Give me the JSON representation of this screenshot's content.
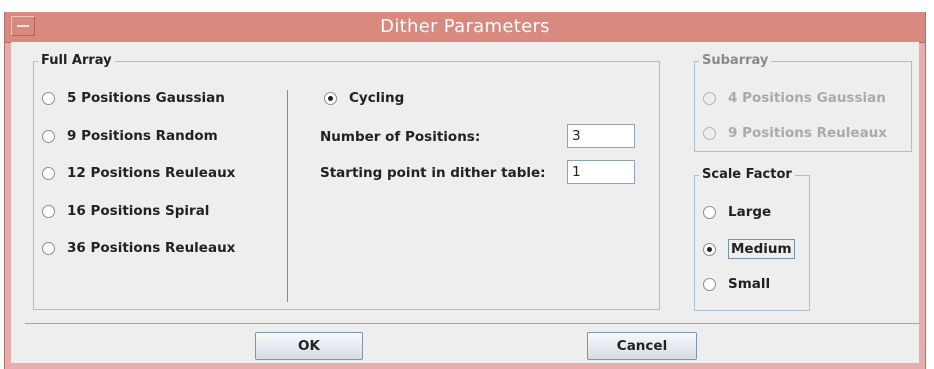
{
  "window": {
    "title": "Dither Parameters"
  },
  "full_array": {
    "legend": "Full Array",
    "options": [
      {
        "label": "5 Positions Gaussian",
        "checked": false
      },
      {
        "label": "9 Positions Random",
        "checked": false
      },
      {
        "label": "12 Positions Reuleaux",
        "checked": false
      },
      {
        "label": "16 Positions Spiral",
        "checked": false
      },
      {
        "label": "36 Positions Reuleaux",
        "checked": false
      }
    ],
    "cycling": {
      "label": "Cycling",
      "checked": true,
      "num_positions_label": "Number of Positions:",
      "num_positions_value": "3",
      "start_point_label": "Starting point in dither table:",
      "start_point_value": "1"
    }
  },
  "subarray": {
    "legend": "Subarray",
    "enabled": false,
    "options": [
      {
        "label": "4 Positions Gaussian",
        "checked": false
      },
      {
        "label": "9 Positions Reuleaux",
        "checked": false
      }
    ]
  },
  "scale_factor": {
    "legend": "Scale Factor",
    "options": [
      {
        "label": "Large",
        "checked": false
      },
      {
        "label": "Medium",
        "checked": true
      },
      {
        "label": "Small",
        "checked": false
      }
    ]
  },
  "buttons": {
    "ok": "OK",
    "cancel": "Cancel"
  },
  "colors": {
    "titlebar": "#d9897d",
    "window_frame": "#e9acac",
    "client_bg": "#eeeeee",
    "group_border": "#a7c1d4"
  }
}
